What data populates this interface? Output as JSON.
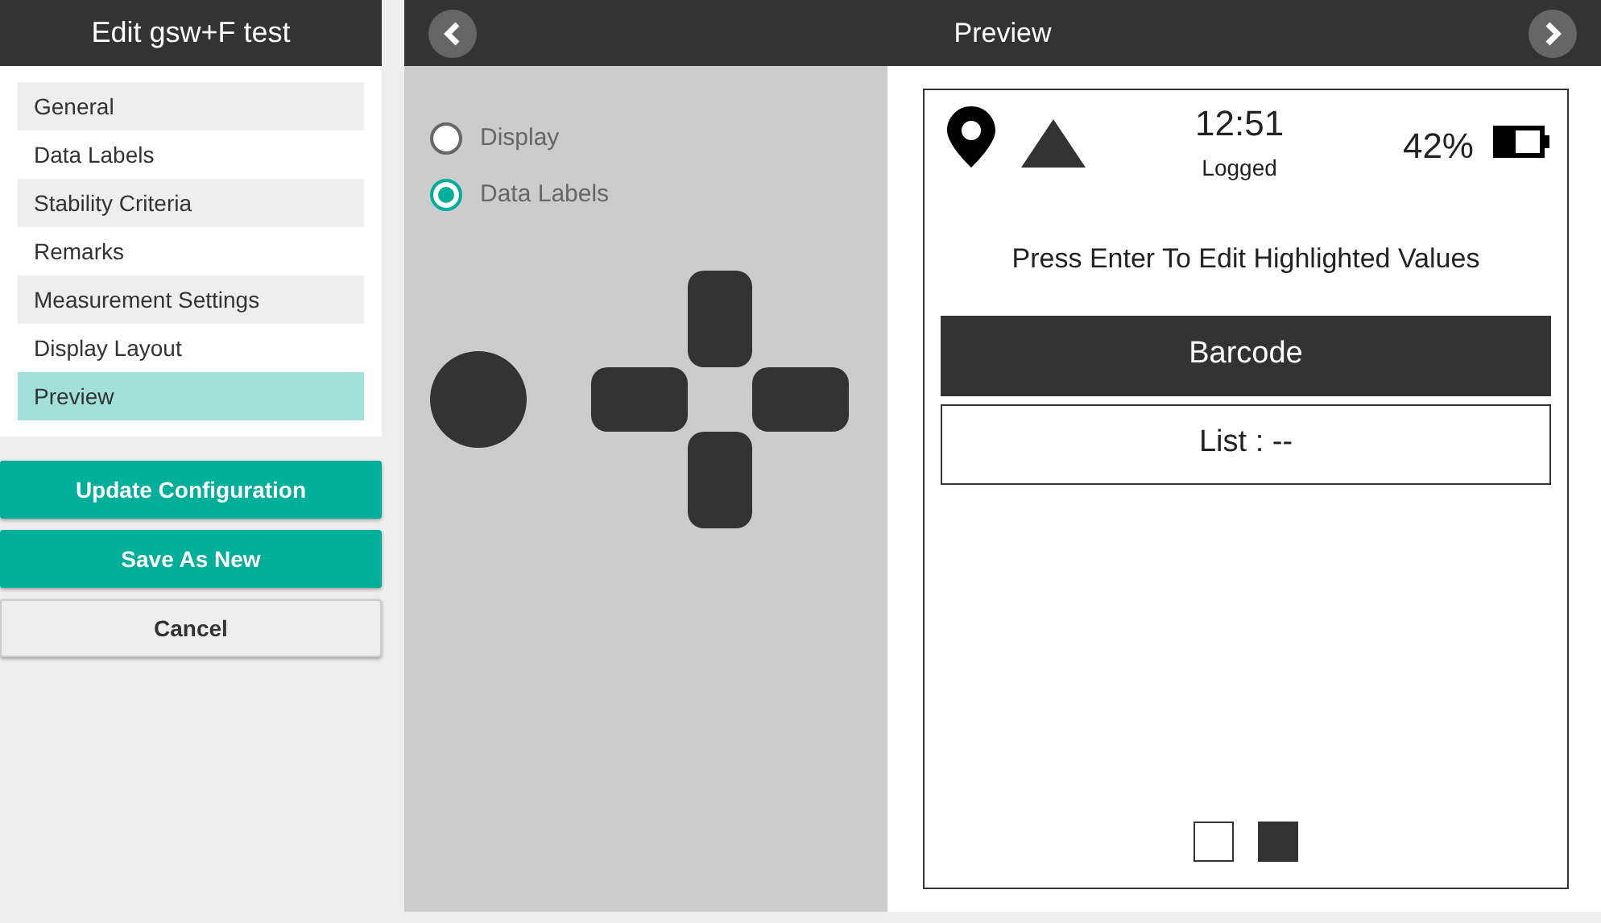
{
  "sidebar": {
    "title": "Edit gsw+F test",
    "items": [
      {
        "label": "General",
        "selected": false
      },
      {
        "label": "Data Labels",
        "selected": false
      },
      {
        "label": "Stability Criteria",
        "selected": false
      },
      {
        "label": "Remarks",
        "selected": false
      },
      {
        "label": "Measurement Settings",
        "selected": false
      },
      {
        "label": "Display Layout",
        "selected": false
      },
      {
        "label": "Preview",
        "selected": true
      }
    ],
    "buttons": [
      {
        "label": "Update Configuration",
        "kind": "primary"
      },
      {
        "label": "Save As New",
        "kind": "primary"
      },
      {
        "label": "Cancel",
        "kind": "secondary"
      }
    ]
  },
  "preview": {
    "title": "Preview",
    "modes": [
      {
        "label": "Display",
        "selected": false
      },
      {
        "label": "Data Labels",
        "selected": true
      }
    ],
    "device": {
      "time": "12:51",
      "status": "Logged",
      "battery": "42%",
      "message": "Press Enter To Edit Highlighted Values",
      "fields": [
        {
          "label": "Barcode",
          "selected": true
        },
        {
          "label": "List : --",
          "selected": false
        }
      ],
      "pages": [
        {
          "selected": false
        },
        {
          "selected": true
        }
      ]
    }
  }
}
